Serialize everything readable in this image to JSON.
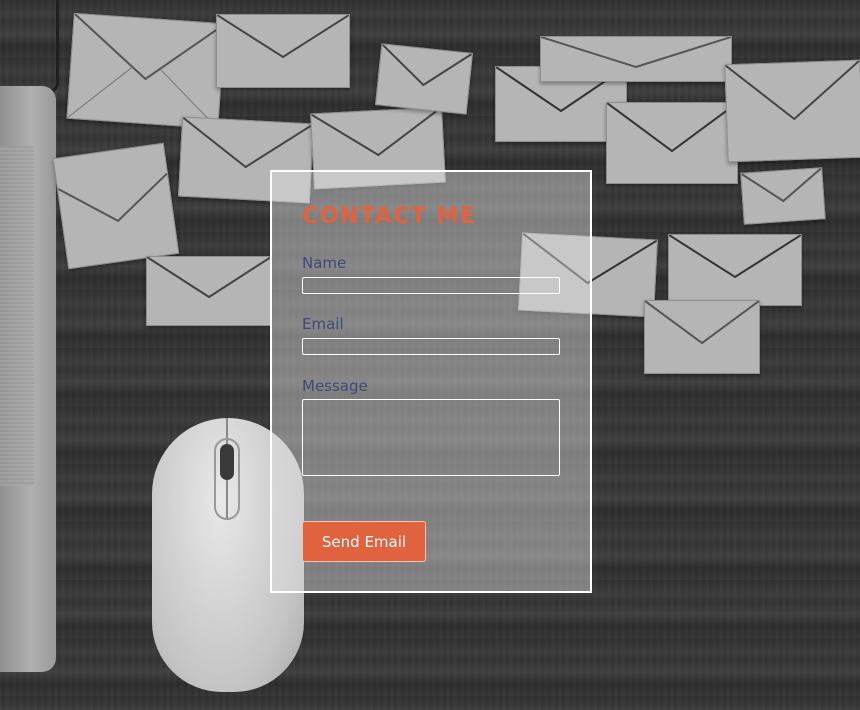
{
  "contact_form": {
    "title": "CONTACT ME",
    "name_label": "Name",
    "name_value": "",
    "email_label": "Email",
    "email_value": "",
    "message_label": "Message",
    "message_value": "",
    "submit_label": "Send Email"
  },
  "theme": {
    "accent": "#e0623f",
    "label_color": "#3e4a78",
    "card_border": "#ffffff"
  },
  "background": {
    "description_icons": [
      "laptop-icon",
      "mouse-icon",
      "envelope-icon"
    ]
  }
}
